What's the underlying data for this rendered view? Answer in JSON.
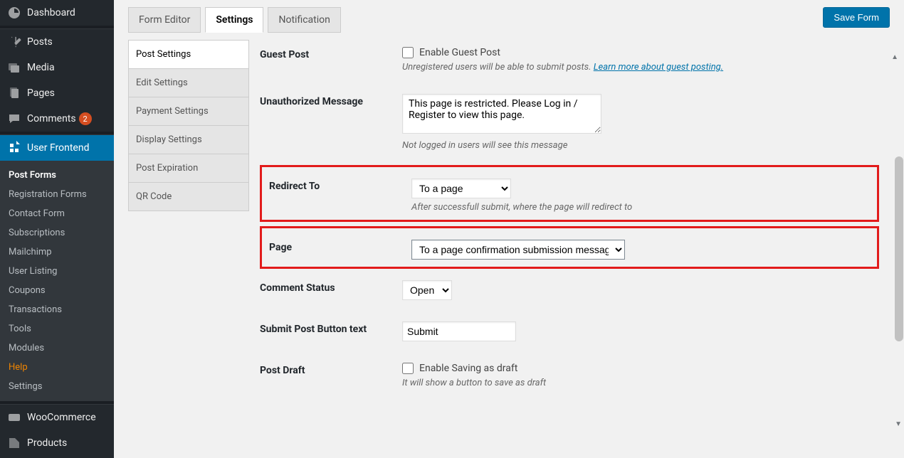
{
  "sidebar": {
    "items": [
      {
        "label": "Dashboard"
      },
      {
        "label": "Posts"
      },
      {
        "label": "Media"
      },
      {
        "label": "Pages"
      },
      {
        "label": "Comments",
        "badge": "2"
      },
      {
        "label": "User Frontend"
      },
      {
        "label": "WooCommerce"
      },
      {
        "label": "Products"
      }
    ],
    "submenu": [
      {
        "label": "Post Forms"
      },
      {
        "label": "Registration Forms"
      },
      {
        "label": "Contact Form"
      },
      {
        "label": "Subscriptions"
      },
      {
        "label": "Mailchimp"
      },
      {
        "label": "User Listing"
      },
      {
        "label": "Coupons"
      },
      {
        "label": "Transactions"
      },
      {
        "label": "Tools"
      },
      {
        "label": "Modules"
      },
      {
        "label": "Help"
      },
      {
        "label": "Settings"
      }
    ]
  },
  "tabs": {
    "main": [
      {
        "label": "Form Editor"
      },
      {
        "label": "Settings"
      },
      {
        "label": "Notification"
      }
    ],
    "side": [
      {
        "label": "Post Settings"
      },
      {
        "label": "Edit Settings"
      },
      {
        "label": "Payment Settings"
      },
      {
        "label": "Display Settings"
      },
      {
        "label": "Post Expiration"
      },
      {
        "label": "QR Code"
      }
    ]
  },
  "actions": {
    "save": "Save Form"
  },
  "form": {
    "guest_post": {
      "label": "Guest Post",
      "checkbox": "Enable Guest Post",
      "help": "Unregistered users will be able to submit posts.",
      "link": "Learn more about guest posting."
    },
    "unauthorized": {
      "label": "Unauthorized Message",
      "value": "This page is restricted. Please Log in / Register to view this page.",
      "help": "Not logged in users will see this message"
    },
    "redirect": {
      "label": "Redirect To",
      "value": "To a page",
      "help": "After successfull submit, where the page will redirect to"
    },
    "page": {
      "label": "Page",
      "value": "To a page confirmation submission message"
    },
    "comment_status": {
      "label": "Comment Status",
      "value": "Open"
    },
    "submit_btn": {
      "label": "Submit Post Button text",
      "value": "Submit"
    },
    "post_draft": {
      "label": "Post Draft",
      "checkbox": "Enable Saving as draft",
      "help": "It will show a button to save as draft"
    }
  }
}
